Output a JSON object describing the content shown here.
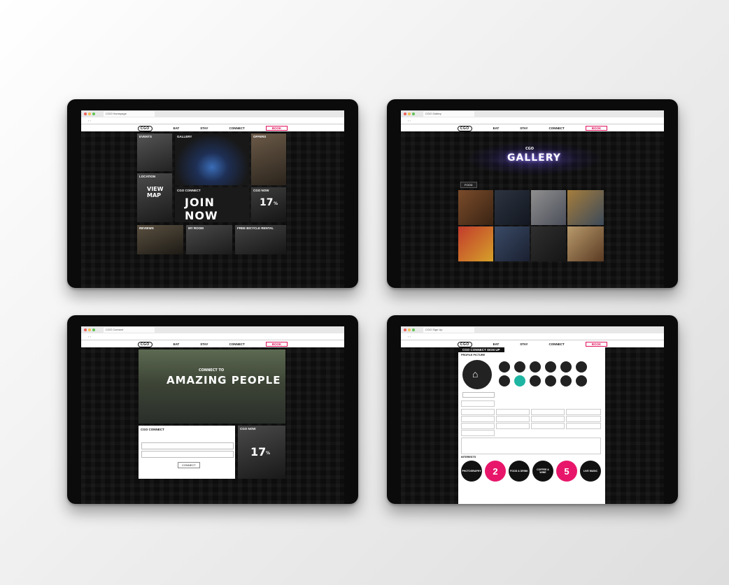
{
  "screens": [
    {
      "tab_title": "CGO Homepage",
      "nav": {
        "logo": "CGO",
        "items": [
          "EAT",
          "STAY",
          "CONNECT"
        ],
        "book": "BOOK"
      },
      "tiles": {
        "events": "EVENTS",
        "gallery": "GALLERY",
        "offers": "OFFERS",
        "location": "LOCATION",
        "view_map": "VIEW MAP",
        "connect": "CGO CONNECT",
        "join_now": "JOIN NOW",
        "cgo_now": "CGO NOW",
        "stat": "17",
        "stat_unit": "%",
        "reviews": "REVIEWS",
        "my_room": "MY ROOM",
        "bicycle": "FREE BICYCLE RENTAL"
      }
    },
    {
      "tab_title": "CGO Gallery",
      "nav": {
        "logo": "CGO",
        "items": [
          "EAT",
          "STAY",
          "CONNECT"
        ],
        "book": "BOOK"
      },
      "hero_small": "CGO",
      "hero_title": "GALLERY",
      "filter": "FOOD"
    },
    {
      "tab_title": "CGO Connect",
      "nav": {
        "logo": "CGO",
        "items": [
          "EAT",
          "STAY",
          "CONNECT"
        ],
        "book": "BOOK"
      },
      "hero_small": "CONNECT TO",
      "hero_title": "AMAZING PEOPLE",
      "connect_title": "CGO CONNECT",
      "connect_button": "CONNECT",
      "cgo_now": "CGO NOW",
      "stat": "17",
      "stat_unit": "%"
    },
    {
      "tab_title": "CGO Sign Up",
      "nav": {
        "logo": "CGO",
        "items": [
          "EAT",
          "STAY",
          "CONNECT"
        ],
        "book": "BOOK"
      },
      "form_title": "CGO CONNECT SIGN UP",
      "profile_label": "PROFILE PICTURE",
      "interests_label": "INTERESTS",
      "bubbles": [
        "PHOTOGRAPHY",
        "2",
        "FOOD & DRINK",
        "COFFEE & WINE",
        "5",
        "LIVE MUSIC"
      ]
    }
  ],
  "colors": {
    "accent": "#e8166a",
    "teal": "#1fb5a3",
    "bezel": "#0b0b0b"
  }
}
